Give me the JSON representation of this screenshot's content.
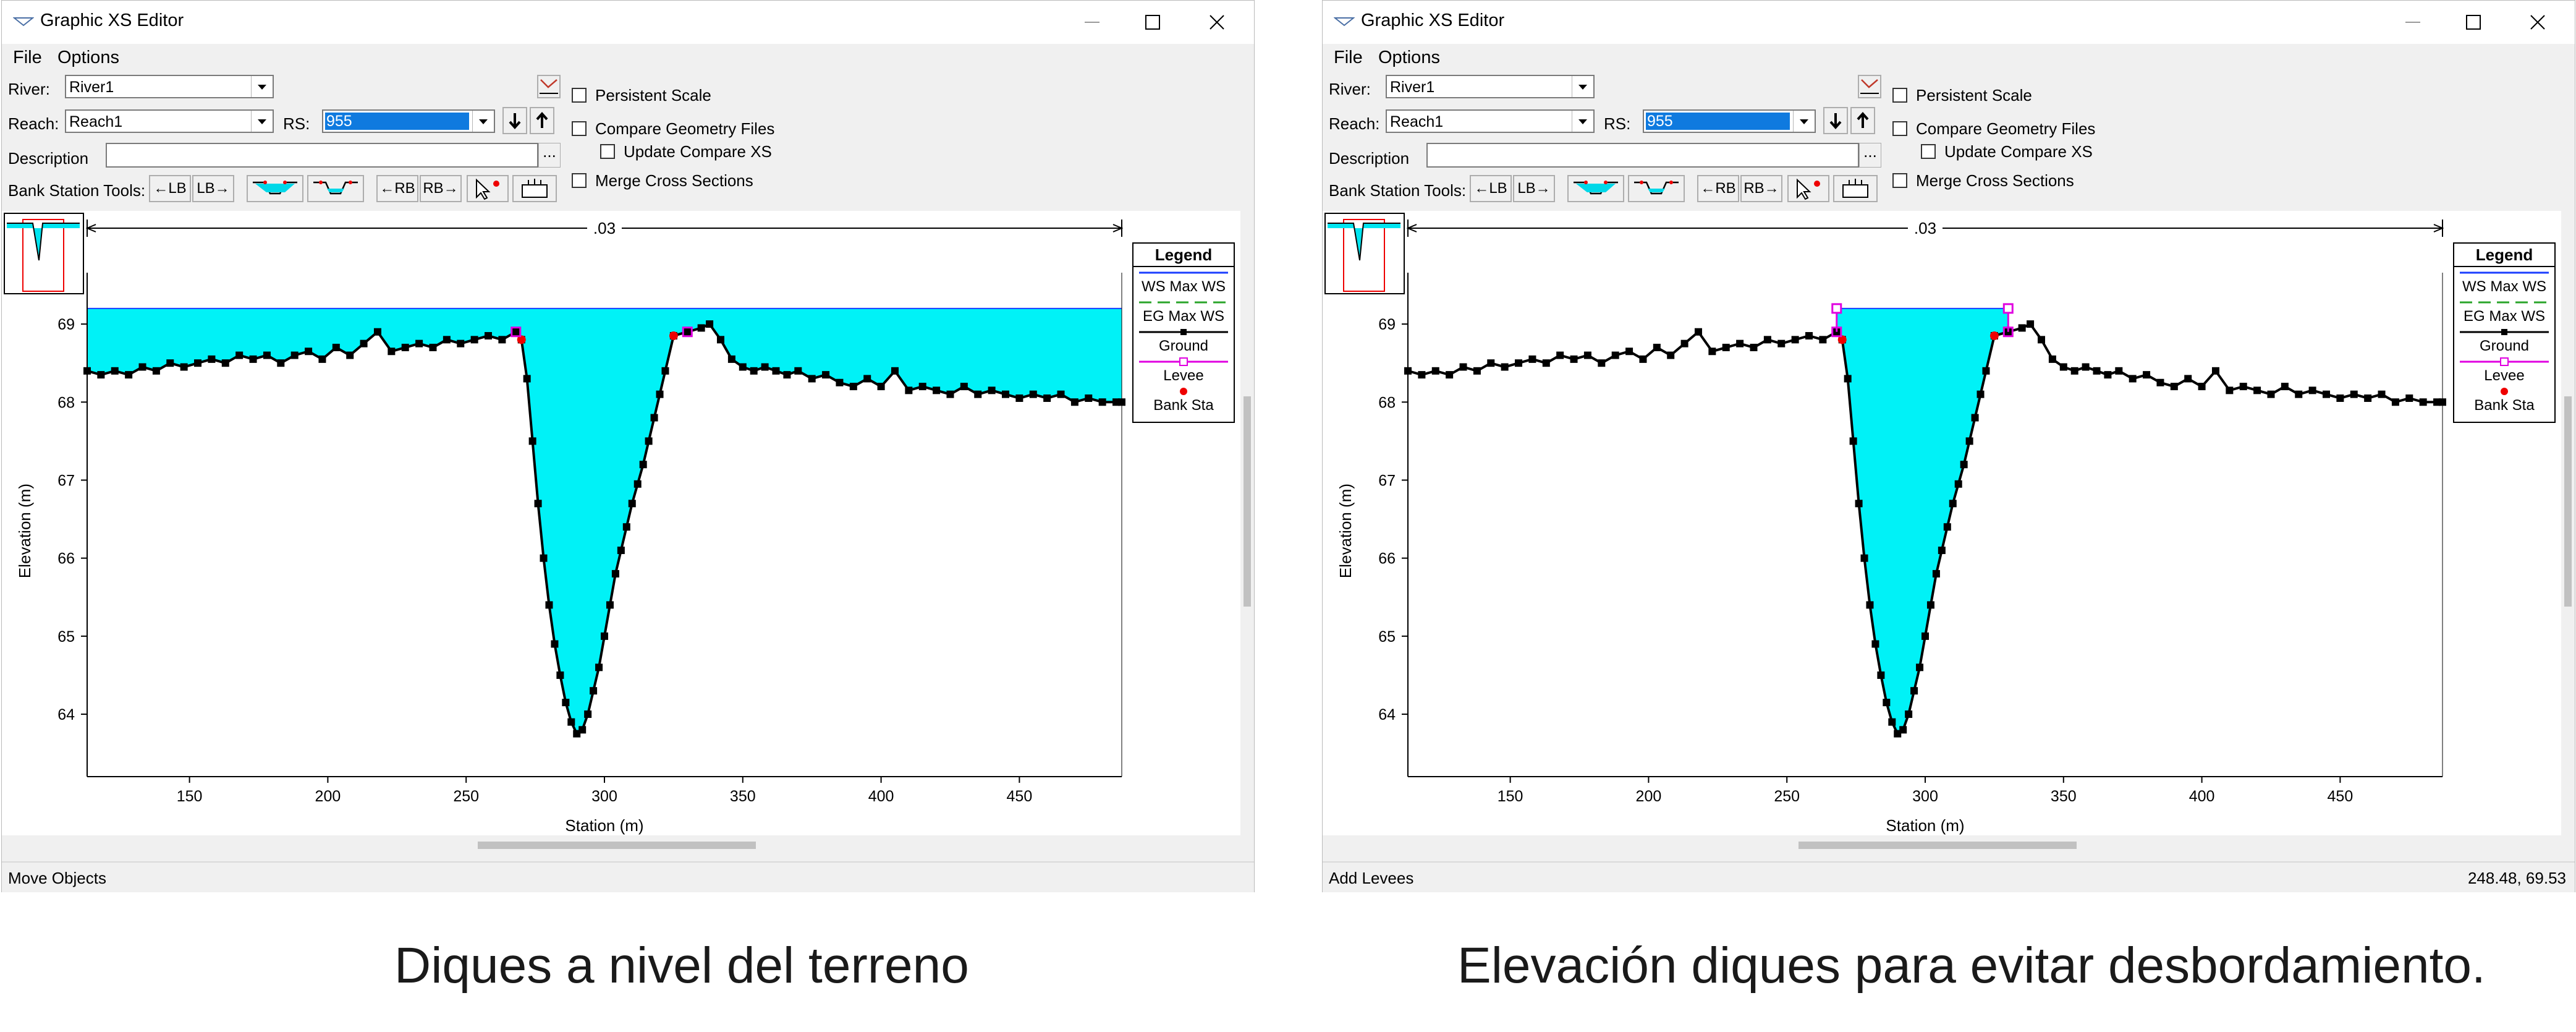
{
  "windows": [
    {
      "id": "left",
      "title": "Graphic XS Editor",
      "menu": [
        "File",
        "Options"
      ],
      "river_label": "River:",
      "river_value": "River1",
      "reach_label": "Reach:",
      "reach_value": "Reach1",
      "rs_label": "RS:",
      "rs_value": "955",
      "description_label": "Description",
      "ellipsis": "...",
      "bank_tools_label": "Bank Station Tools:",
      "tools": [
        "←LB",
        "LB→",
        "",
        "",
        "←RB",
        "RB→",
        "",
        ""
      ],
      "checkboxes": [
        "Persistent Scale",
        "Compare Geometry Files",
        "Update Compare XS",
        "Merge Cross Sections"
      ],
      "status_text": "Move Objects",
      "status_coords": "",
      "levees_raised": false
    },
    {
      "id": "right",
      "title": "Graphic XS Editor",
      "menu": [
        "File",
        "Options"
      ],
      "river_label": "River:",
      "river_value": "River1",
      "reach_label": "Reach:",
      "reach_value": "Reach1",
      "rs_label": "RS:",
      "rs_value": "955",
      "description_label": "Description",
      "ellipsis": "...",
      "bank_tools_label": "Bank Station Tools:",
      "tools": [
        "←LB",
        "LB→",
        "",
        "",
        "←RB",
        "RB→",
        "",
        ""
      ],
      "checkboxes": [
        "Persistent Scale",
        "Compare Geometry Files",
        "Update Compare XS",
        "Merge Cross Sections"
      ],
      "status_text": "Add Levees",
      "status_coords": "248.48, 69.53",
      "levees_raised": true
    }
  ],
  "chart_data": {
    "type": "line",
    "xlabel": "Station (m)",
    "ylabel": "Elevation (m)",
    "xlim": [
      113,
      487
    ],
    "ylim": [
      63.2,
      69.5
    ],
    "xticks": [
      150,
      200,
      250,
      300,
      350,
      400,
      450
    ],
    "yticks": [
      64,
      65,
      66,
      67,
      68,
      69
    ],
    "manning_n_label": ".03",
    "ws_elevation": 69.2,
    "bank_stations": [
      270,
      325
    ],
    "levee_stations": [
      268,
      330
    ],
    "levee_top_elevation": 69.2,
    "legend_title": "Legend",
    "legend": [
      "WS Max WS",
      "EG Max WS",
      "Ground",
      "Levee",
      "Bank Sta"
    ],
    "series": [
      {
        "name": "Ground",
        "x": [
          113,
          118,
          123,
          128,
          133,
          138,
          143,
          148,
          153,
          158,
          163,
          168,
          173,
          178,
          183,
          188,
          193,
          198,
          203,
          208,
          213,
          218,
          223,
          228,
          233,
          238,
          243,
          248,
          253,
          258,
          263,
          268,
          270,
          272,
          274,
          276,
          278,
          280,
          282,
          284,
          286,
          288,
          290,
          292,
          294,
          296,
          298,
          300,
          302,
          304,
          306,
          308,
          310,
          312,
          314,
          316,
          318,
          320,
          322,
          325,
          330,
          335,
          338,
          342,
          346,
          350,
          354,
          358,
          362,
          366,
          370,
          375,
          380,
          385,
          390,
          395,
          400,
          405,
          410,
          415,
          420,
          425,
          430,
          435,
          440,
          445,
          450,
          455,
          460,
          465,
          470,
          475,
          480,
          485,
          487
        ],
        "y": [
          68.4,
          68.35,
          68.4,
          68.35,
          68.45,
          68.4,
          68.5,
          68.45,
          68.5,
          68.55,
          68.5,
          68.6,
          68.55,
          68.6,
          68.5,
          68.6,
          68.65,
          68.55,
          68.7,
          68.6,
          68.75,
          68.9,
          68.65,
          68.7,
          68.75,
          68.7,
          68.8,
          68.75,
          68.8,
          68.85,
          68.8,
          68.9,
          68.8,
          68.3,
          67.5,
          66.7,
          66.0,
          65.4,
          64.9,
          64.5,
          64.15,
          63.9,
          63.75,
          63.8,
          64.0,
          64.3,
          64.6,
          65.0,
          65.4,
          65.8,
          66.1,
          66.4,
          66.7,
          66.95,
          67.2,
          67.5,
          67.8,
          68.1,
          68.4,
          68.85,
          68.9,
          68.95,
          69.0,
          68.8,
          68.55,
          68.45,
          68.4,
          68.45,
          68.4,
          68.35,
          68.4,
          68.3,
          68.35,
          68.25,
          68.2,
          68.3,
          68.2,
          68.4,
          68.15,
          68.2,
          68.15,
          68.1,
          68.2,
          68.1,
          68.15,
          68.1,
          68.05,
          68.1,
          68.05,
          68.1,
          68.0,
          68.05,
          68.0,
          68.0,
          68.0
        ]
      }
    ]
  },
  "captions": [
    "Diques a nivel del terreno",
    "Elevación diques para evitar desbordamiento."
  ]
}
